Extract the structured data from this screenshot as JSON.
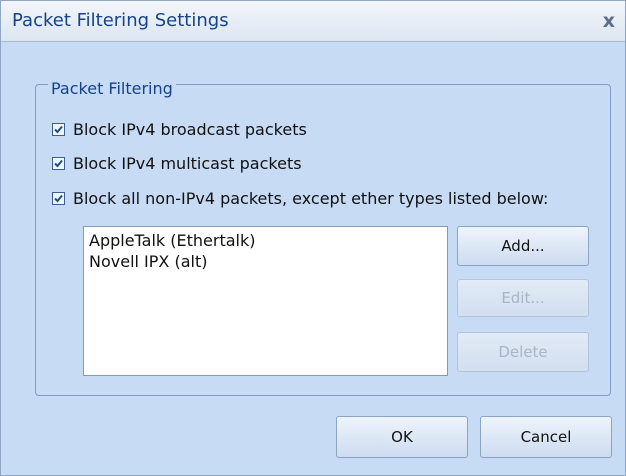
{
  "dialog": {
    "title": "Packet Filtering Settings",
    "close_glyph": "x",
    "group_title": "Packet Filtering",
    "checkboxes": [
      {
        "label": "Block IPv4 broadcast packets",
        "checked": true
      },
      {
        "label": "Block IPv4 multicast packets",
        "checked": true
      },
      {
        "label": "Block all non-IPv4 packets, except ether types listed below:",
        "checked": true
      }
    ],
    "ether_types": [
      "AppleTalk (Ethertalk)",
      "Novell IPX (alt)"
    ],
    "buttons": {
      "add": "Add...",
      "edit": "Edit...",
      "delete": "Delete",
      "ok": "OK",
      "cancel": "Cancel"
    }
  },
  "colors": {
    "dialog_background": "#c7dbf5",
    "title_text": "#15428b",
    "group_border": "#7f9dc4",
    "check_mark": "#1e4f8f"
  }
}
